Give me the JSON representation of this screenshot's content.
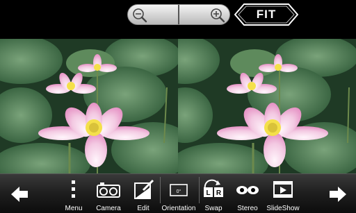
{
  "header": {
    "fit_label": "FIT",
    "icons": {
      "zoom_out": "zoom-out-icon",
      "zoom_in": "zoom-in-icon"
    }
  },
  "photo": {
    "description_icons": [
      "lotus-photo-left",
      "lotus-photo-right"
    ]
  },
  "toolbar": {
    "prev_icon": "arrow-left-icon",
    "next_icon": "arrow-right-icon",
    "items": [
      {
        "label": "Menu",
        "icon": "menu-dots-icon"
      },
      {
        "label": "Camera",
        "icon": "stereo-camera-icon"
      },
      {
        "label": "Edit",
        "icon": "edit-icon"
      },
      {
        "label": "Orientation",
        "icon": "orientation-icon"
      },
      {
        "label": "Swap",
        "icon": "swap-lr-icon"
      },
      {
        "label": "Stereo",
        "icon": "stereo-glasses-icon"
      },
      {
        "label": "SlideShow",
        "icon": "slideshow-icon"
      }
    ]
  },
  "colors": {
    "toolbar_bg": "#202020",
    "leaf_dark": "#2f5a38",
    "leaf_light": "#6f9a6a",
    "petal": "#f3c9e2",
    "petal_tip": "#e58fc3",
    "stamen": "#f4e04a"
  }
}
